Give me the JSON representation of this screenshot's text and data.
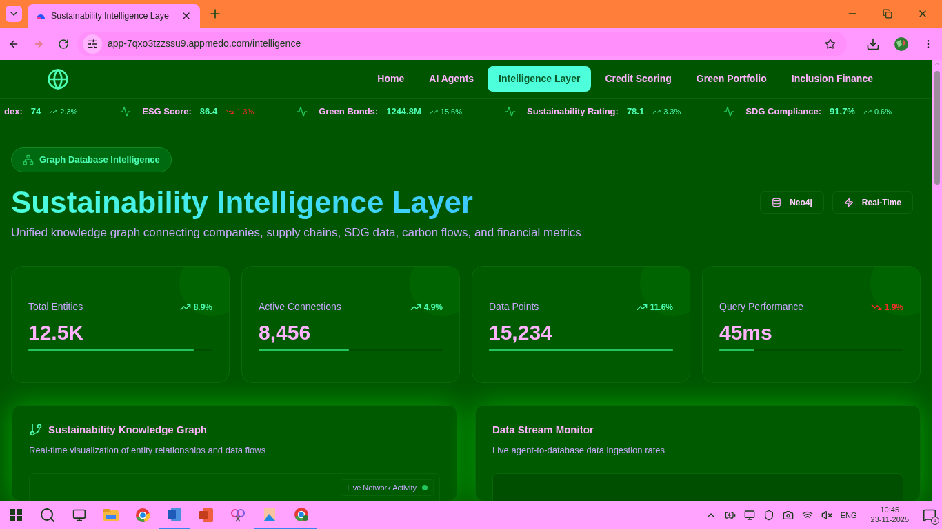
{
  "browser": {
    "tab_title": "Sustainability Intelligence Laye",
    "url": "app-7qxo3tzzssu9.appmedo.com/intelligence"
  },
  "nav": [
    {
      "label": "Home",
      "selected": false
    },
    {
      "label": "AI Agents",
      "selected": false
    },
    {
      "label": "Intelligence Layer",
      "selected": true
    },
    {
      "label": "Credit Scoring",
      "selected": false
    },
    {
      "label": "Green Portfolio",
      "selected": false
    },
    {
      "label": "Inclusion Finance",
      "selected": false
    }
  ],
  "ticker": [
    {
      "label": "dex:",
      "value": "74",
      "change": "2.3%",
      "falling": false
    },
    {
      "label": "ESG Score:",
      "value": "86.4",
      "change": "1.3%",
      "falling": true
    },
    {
      "label": "Green Bonds:",
      "value": "1244.8M",
      "change": "15.6%",
      "falling": false
    },
    {
      "label": "Sustainability Rating:",
      "value": "78.1",
      "change": "3.3%",
      "falling": false
    },
    {
      "label": "SDG Compliance:",
      "value": "91.7%",
      "change": "0.6%",
      "falling": false
    }
  ],
  "badge": "Graph Database Intelligence",
  "title": "Sustainability Intelligence Layer",
  "subtitle": "Unified knowledge graph connecting companies, supply chains, SDG data, carbon flows, and financial metrics",
  "tags": [
    {
      "kind": "database",
      "label": "Neo4j"
    },
    {
      "kind": "bolt",
      "label": "Real-Time"
    }
  ],
  "stats": [
    {
      "label": "Total Entities",
      "value": "12.5K",
      "change": "8.9%",
      "falling": false,
      "level": 0.9
    },
    {
      "label": "Active Connections",
      "value": "8,456",
      "change": "4.9%",
      "falling": false,
      "level": 0.49
    },
    {
      "label": "Data Points",
      "value": "15,234",
      "change": "11.6%",
      "falling": false,
      "level": 1
    },
    {
      "label": "Query Performance",
      "value": "45ms",
      "change": "1.9%",
      "falling": true,
      "level": 0.19
    }
  ],
  "graph_panel": {
    "title": "Sustainability Knowledge Graph",
    "subtitle": "Real-time visualization of entity relationships and data flows",
    "live_label": "Live Network Activity"
  },
  "stream_panel": {
    "title": "Data Stream Monitor",
    "subtitle": "Live agent-to-database data ingestion rates"
  },
  "taskbar": {
    "lang": "ENG",
    "time": "10:45",
    "date": "23-11-2025",
    "notifications": "1"
  }
}
